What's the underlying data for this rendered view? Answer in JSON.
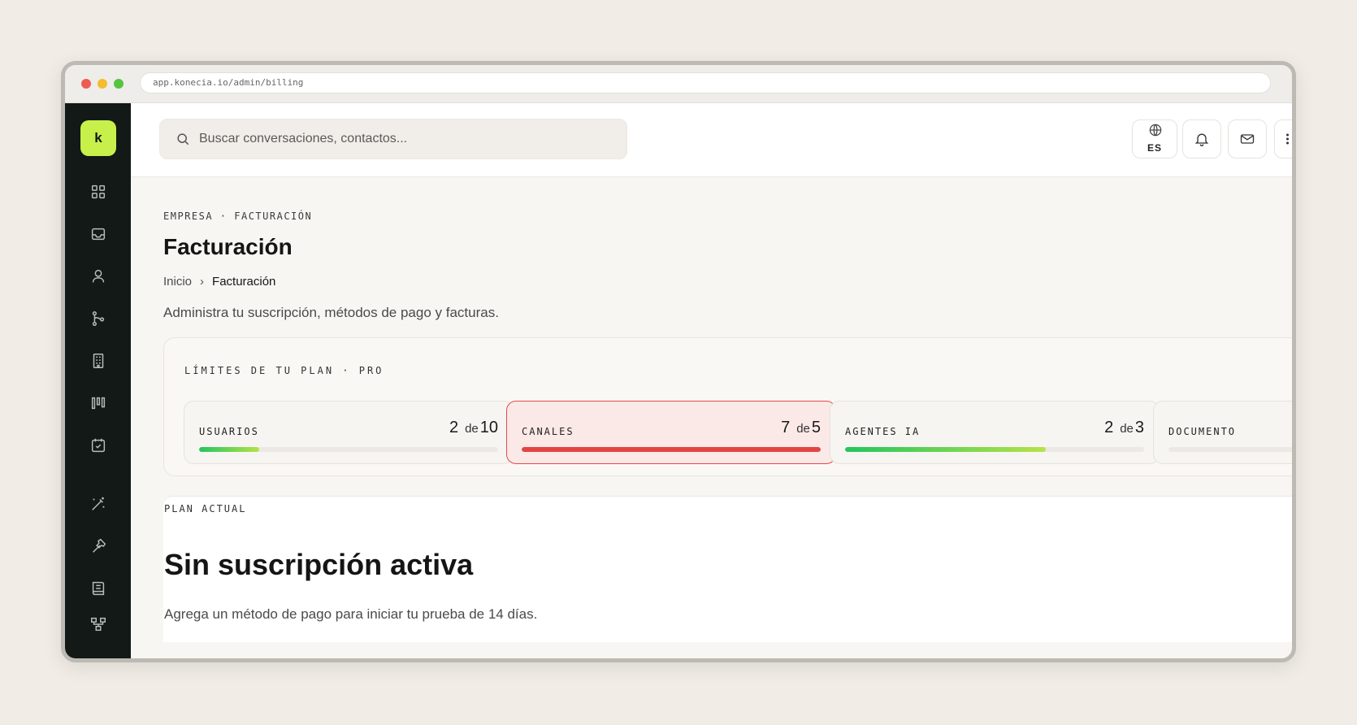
{
  "browser": {
    "url": "app.konecia.io/admin/billing"
  },
  "sidebar": {
    "logo": "k",
    "items": [
      {
        "icon": "grid-icon"
      },
      {
        "icon": "inbox-icon"
      },
      {
        "icon": "user-icon"
      },
      {
        "icon": "git-branch-icon"
      },
      {
        "icon": "building-icon"
      },
      {
        "icon": "kanban-icon"
      },
      {
        "icon": "calendar-check-icon"
      },
      {
        "icon": "magic-wand-icon"
      },
      {
        "icon": "hammer-icon"
      },
      {
        "icon": "book-icon"
      },
      {
        "icon": "network-icon"
      }
    ]
  },
  "topbar": {
    "search_placeholder": "Buscar conversaciones, contactos...",
    "language": "ES"
  },
  "page": {
    "eyebrow": "EMPRESA · FACTURACIÓN",
    "title": "Facturación",
    "breadcrumb": {
      "home": "Inicio",
      "current": "Facturación"
    },
    "subtitle": "Administra tu suscripción, métodos de pago y facturas."
  },
  "limits": {
    "title": "LÍMITES DE TU PLAN · PRO",
    "of_word": "de",
    "items": [
      {
        "name": "USUARIOS",
        "used": 2,
        "max": 10,
        "fraction": 0.2
      },
      {
        "name": "CANALES",
        "used": 7,
        "max": 5,
        "fraction": 1.0,
        "status": "over-limit"
      },
      {
        "name": "AGENTES IA",
        "used": 2,
        "max": 3,
        "fraction": 0.67
      },
      {
        "name": "DOCUMENTO"
      }
    ]
  },
  "plan": {
    "label": "PLAN ACTUAL",
    "status": "Sin suscripción activa",
    "description": "Agrega un método de pago para iniciar tu prueba de 14 días."
  },
  "colors": {
    "accent": "#c7f04a",
    "sidebar_bg": "#121917",
    "danger": "#e24444",
    "progress_start": "#22c55e",
    "progress_end": "#b6e24a"
  }
}
